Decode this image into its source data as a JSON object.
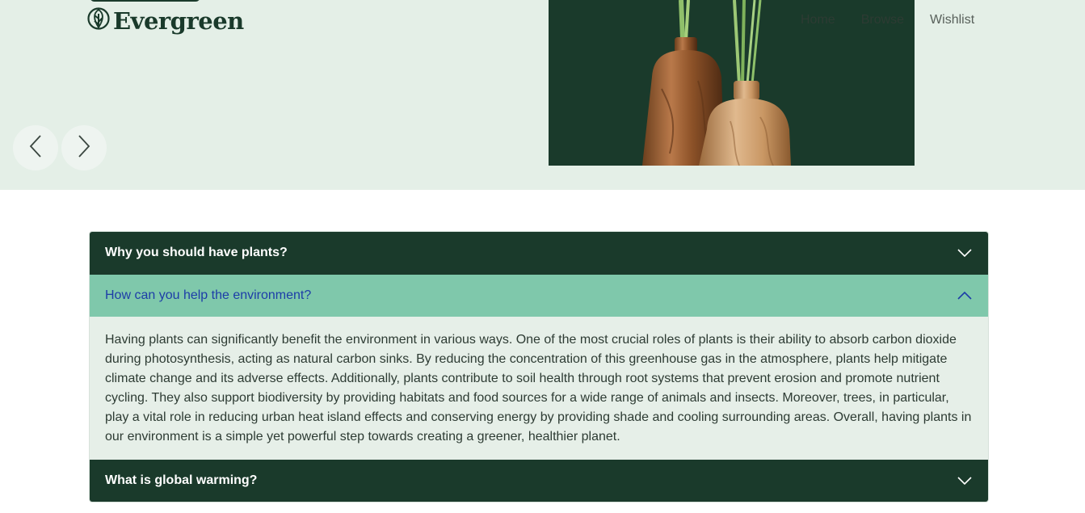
{
  "brand": {
    "name": "Evergreen",
    "logo_icon": "leaf-icon"
  },
  "nav": {
    "items": [
      {
        "label": "Home"
      },
      {
        "label": "Browse"
      },
      {
        "label": "Wishlist"
      }
    ]
  },
  "carousel": {
    "prev_icon": "chevron-left-icon",
    "next_icon": "chevron-right-icon"
  },
  "hero_image": {
    "subject": "wooden vases with green stems"
  },
  "colors": {
    "dark_green": "#1a3a2b",
    "mint": "#7fc8ab",
    "pale": "#e4efe7",
    "link_blue": "#1d3da8"
  },
  "faq": {
    "items": [
      {
        "question": "Why you should have plants?",
        "expanded": false
      },
      {
        "question": "How can you help the environment?",
        "expanded": true,
        "answer": "Having plants can significantly benefit the environment in various ways. One of the most crucial roles of plants is their ability to absorb carbon dioxide during photosynthesis, acting as natural carbon sinks. By reducing the concentration of this greenhouse gas in the atmosphere, plants help mitigate climate change and its adverse effects. Additionally, plants contribute to soil health through root systems that prevent erosion and promote nutrient cycling. They also support biodiversity by providing habitats and food sources for a wide range of animals and insects. Moreover, trees, in particular, play a vital role in reducing urban heat island effects and conserving energy by providing shade and cooling surrounding areas. Overall, having plants in our environment is a simple yet powerful step towards creating a greener, healthier planet."
      },
      {
        "question": "What is global warming?",
        "expanded": false
      }
    ]
  }
}
